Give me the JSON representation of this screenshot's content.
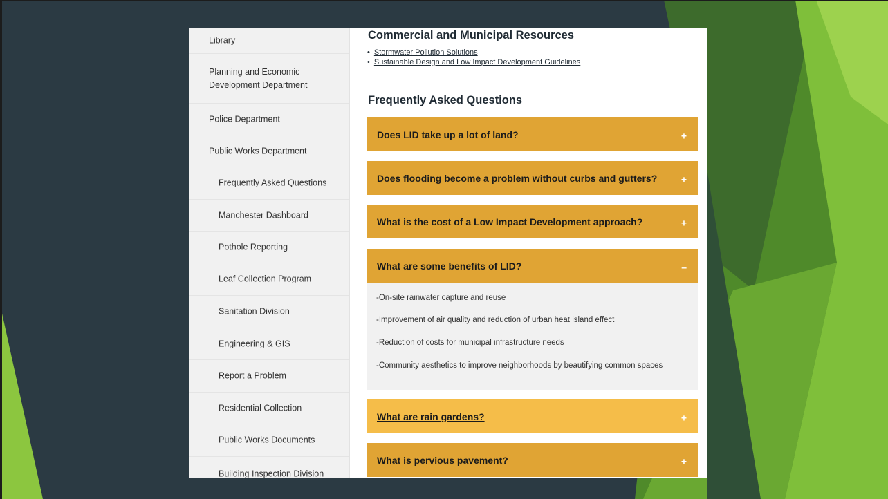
{
  "colors": {
    "background": "#2b3a43",
    "accordion": "#e0a434",
    "accordion_hover": "#f5bd49",
    "accent_green": "#8cc63f",
    "dark_green": "#3d6b2c"
  },
  "sidebar": {
    "items": [
      {
        "label": "Library",
        "level": 1
      },
      {
        "label": "Planning and Economic Development Department",
        "level": 1
      },
      {
        "label": "Police Department",
        "level": 1
      },
      {
        "label": "Public Works Department",
        "level": 1
      },
      {
        "label": "Frequently Asked Questions",
        "level": 2
      },
      {
        "label": "Manchester Dashboard",
        "level": 2
      },
      {
        "label": "Pothole Reporting",
        "level": 2
      },
      {
        "label": "Leaf Collection Program",
        "level": 2
      },
      {
        "label": "Sanitation Division",
        "level": 2
      },
      {
        "label": "Engineering & GIS",
        "level": 2
      },
      {
        "label": "Report a Problem",
        "level": 2
      },
      {
        "label": "Residential Collection",
        "level": 2
      },
      {
        "label": "Public Works Documents",
        "level": 2
      },
      {
        "label": "Building Inspection Division",
        "level": 2
      }
    ]
  },
  "main": {
    "resources_heading": "Commercial and Municipal Resources",
    "resources": [
      "Stormwater Pollution Solutions",
      "Sustainable Design and Low Impact Development Guidelines"
    ],
    "faq_heading": "Frequently Asked Questions",
    "faq": [
      {
        "question": "Does LID take up a lot of land?",
        "toggle": "+"
      },
      {
        "question": "Does flooding become a problem without curbs and gutters?",
        "toggle": "+"
      },
      {
        "question": "What is the cost of a Low Impact Development approach?",
        "toggle": "+"
      },
      {
        "question": "What are some benefits of LID?",
        "toggle": "–",
        "answers": [
          "-On-site rainwater capture and reuse",
          "-Improvement of air quality and reduction of urban heat island effect",
          "-Reduction of costs for municipal infrastructure needs",
          "-Community aesthetics to improve neighborhoods by beautifying common spaces"
        ]
      },
      {
        "question": "What are rain gardens?",
        "toggle": "+"
      },
      {
        "question": "What is pervious pavement?",
        "toggle": "+"
      }
    ]
  }
}
